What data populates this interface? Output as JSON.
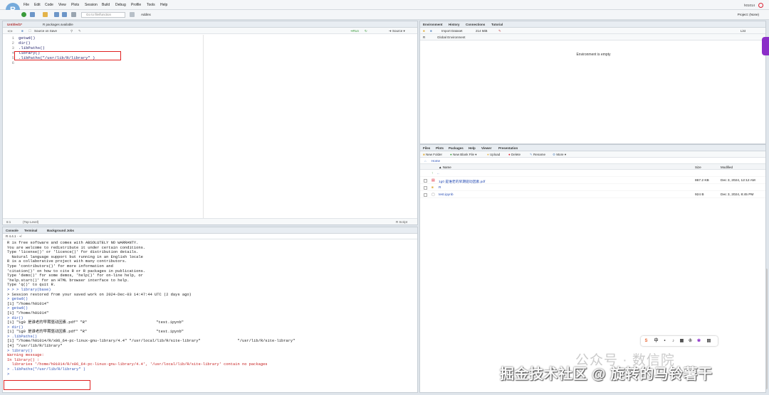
{
  "menubar": {
    "logo": "R",
    "items": [
      "File",
      "Edit",
      "Code",
      "View",
      "Plots",
      "Session",
      "Build",
      "Debug",
      "Profile",
      "Tools",
      "Help"
    ],
    "user": "h01014"
  },
  "toolbar": {
    "goto_placeholder": "Go to file/function",
    "addins": "Addins",
    "project": "Project: (None)"
  },
  "editor": {
    "tabs": [
      "Untitled1*",
      "R packages available"
    ],
    "source_on_save": "Source on Save",
    "run": "Run",
    "source": "Source",
    "lines": [
      "getwd()",
      "dir()",
      ".libPaths()",
      "library()",
      ".libPaths(\"/usr/lib/R/library\" )",
      ""
    ],
    "status_pos": "6:1",
    "status_level": "(Top Level)",
    "status_type": "R Script"
  },
  "console": {
    "tabs": [
      "Console",
      "Terminal",
      "Background Jobs"
    ],
    "context": "R 4.4.1 · ~/",
    "lines": [
      {
        "t": "R is free software and comes with ABSOLUTELY NO WARRANTY.",
        "c": ""
      },
      {
        "t": "You are welcome to redistribute it under certain conditions.",
        "c": ""
      },
      {
        "t": "Type 'license()' or 'licence()' for distribution details.",
        "c": ""
      },
      {
        "t": "",
        "c": ""
      },
      {
        "t": "  Natural language support but running in an English locale",
        "c": ""
      },
      {
        "t": "",
        "c": ""
      },
      {
        "t": "R is a collaborative project with many contributors.",
        "c": ""
      },
      {
        "t": "Type 'contributors()' for more information and",
        "c": ""
      },
      {
        "t": "'citation()' on how to cite R or R packages in publications.",
        "c": ""
      },
      {
        "t": "",
        "c": ""
      },
      {
        "t": "Type 'demo()' for some demos, 'help()' for on-line help, or",
        "c": ""
      },
      {
        "t": "'help.start()' for an HTML browser interface to help.",
        "c": ""
      },
      {
        "t": "Type 'q()' to quit R.",
        "c": ""
      },
      {
        "t": "",
        "c": ""
      },
      {
        "t": "> > > library(base)",
        "c": "cmd"
      },
      {
        "t": "> Session restored from your saved work on 2024-Dec-03 14:47:44 UTC (2 days ago)",
        "c": ""
      },
      {
        "t": "> getwd()",
        "c": "cmd"
      },
      {
        "t": "[1] \"/home/h01014\"",
        "c": ""
      },
      {
        "t": "> getwd()",
        "c": "cmd"
      },
      {
        "t": "[1] \"/home/h01014\"",
        "c": ""
      },
      {
        "t": "> dir()",
        "c": "cmd"
      },
      {
        "t": "[1] \"1g0 是谁老的早期驱动因素.pdf\" \"R\"                              \"test.ipynb\"",
        "c": ""
      },
      {
        "t": "> dir()",
        "c": "cmd"
      },
      {
        "t": "[1] \"1g0 是谁老的早期驱动因素.pdf\" \"R\"                              \"test.ipynb\"",
        "c": ""
      },
      {
        "t": "> .libPaths()",
        "c": "cmd"
      },
      {
        "t": "[1] \"/home/h01014/R/x86_64-pc-linux-gnu-library/4.4\" \"/usr/local/lib/R/site-library\"                \"/usr/lib/R/site-library\"",
        "c": ""
      },
      {
        "t": "[4] \"/usr/lib/R/library\"",
        "c": ""
      },
      {
        "t": "> library()",
        "c": "cmd"
      },
      {
        "t": "Warning message:",
        "c": "warn"
      },
      {
        "t": "In library() :",
        "c": "warn"
      },
      {
        "t": "  libraries '/home/h01014/R/x86_64-pc-linux-gnu-library/4.4', '/usr/local/lib/R/site-library' contain no packages",
        "c": "warn"
      },
      {
        "t": "> .libPaths(\"/usr/lib/R/library\" )",
        "c": "cmd"
      },
      {
        "t": ">",
        "c": "cmd"
      }
    ]
  },
  "env": {
    "tabs": [
      "Environment",
      "History",
      "Connections",
      "Tutorial"
    ],
    "import": "Import Dataset",
    "memory": "214 MiB",
    "list": "List",
    "lang": "R",
    "scope": "Global Environment",
    "empty": "Environment is empty"
  },
  "files": {
    "tabs": [
      "Files",
      "Plots",
      "Packages",
      "Help",
      "Viewer",
      "Presentation"
    ],
    "new_folder": "New Folder",
    "new_blank": "New Blank File",
    "upload": "Upload",
    "delete": "Delete",
    "rename": "Rename",
    "more": "More",
    "path": "Home",
    "headers": [
      "Name",
      "Size",
      "Modified"
    ],
    "up": "..",
    "rows": [
      {
        "name": "1g0 是谁老的早期驱动因素.pdf",
        "size": "867.2 KB",
        "modified": "Dec 3, 2024, 12:12 AM"
      },
      {
        "name": "R",
        "size": "",
        "modified": ""
      },
      {
        "name": "test.ipynb",
        "size": "924 B",
        "modified": "Dec 3, 2024, 8:45 PM"
      }
    ]
  },
  "watermark": {
    "line1": "公众号 · 数信院",
    "line2": "掘金技术社区 @ 旋转的马铃薯干"
  },
  "colors": {
    "accent": "#75aadb",
    "command": "#2a4fb5",
    "warning": "#c62020",
    "highlight": "#e02020"
  }
}
